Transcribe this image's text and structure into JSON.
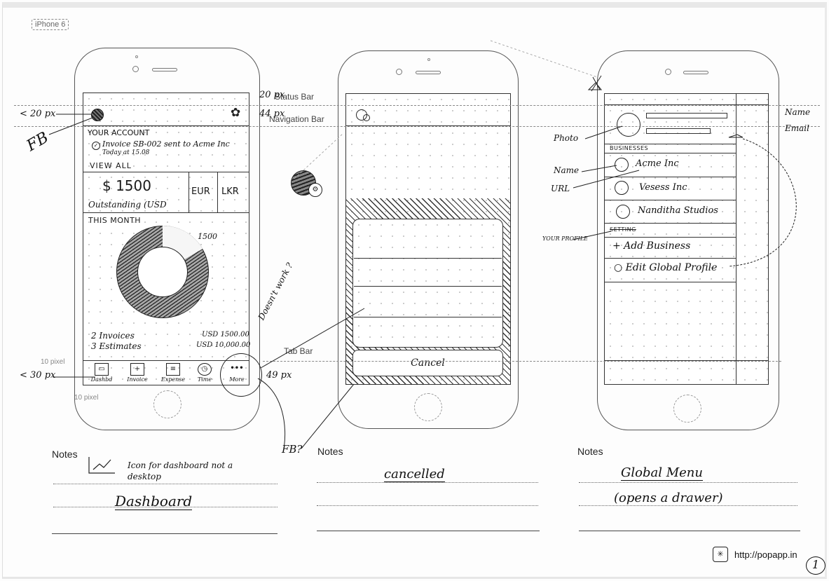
{
  "device_label": "iPhone 6",
  "guides": {
    "status_bar": "Status Bar",
    "navigation_bar": "Navigation Bar",
    "tab_bar": "Tab Bar",
    "ten_pixel_top": "10 pixel",
    "ten_pixel_bottom": "10 pixel"
  },
  "annotations": {
    "status_bar_px": "20 px",
    "nav_bar_px": "44 px",
    "avatar_size": "< 20 px",
    "fb_left": "FB",
    "tab_icon_size": "< 30 px",
    "tab_bar_px": "49 px",
    "doesnt_work": "Doesn't work ?",
    "fb_question": "FB?",
    "photo": "Photo",
    "name_left": "Name",
    "url": "URL",
    "your_profile": "YOUR PROFILE",
    "name_right": "Name",
    "email_right": "Email"
  },
  "screen1": {
    "section_title": "YOUR ACCOUNT",
    "activity_text": "Invoice SB-002 sent to Acme Inc",
    "activity_time": "Today at 15.08",
    "view_all": "VIEW ALL",
    "amount": "$ 1500",
    "amount_caption": "Outstanding (USD",
    "currency_tabs": [
      "EUR",
      "LKR"
    ],
    "month_title": "THIS MONTH",
    "donut_label": "1500",
    "summary": [
      {
        "label": "2 Invoices",
        "value": "USD 1500.00"
      },
      {
        "label": "3 Estimates",
        "value": "USD 10,000.00"
      }
    ],
    "tabs": [
      {
        "label": "Dashbd",
        "icon": "desktop-icon",
        "glyph": "▭"
      },
      {
        "label": "Invoice",
        "icon": "new-invoice-icon",
        "glyph": "+"
      },
      {
        "label": "Expense",
        "icon": "receipt-icon",
        "glyph": "≡"
      },
      {
        "label": "Time",
        "icon": "stopwatch-icon",
        "glyph": "◷"
      },
      {
        "label": "More",
        "icon": "more-dots-icon",
        "glyph": "•••"
      }
    ]
  },
  "screen2": {
    "cancel_label": "Cancel"
  },
  "screen3": {
    "businesses_header": "BUSINESSES",
    "businesses": [
      "Acme Inc",
      "Vesess Inc",
      "Nanditha Studios"
    ],
    "settings_header": "SETTING",
    "menu": [
      {
        "label": "+ Add Business",
        "icon": "plus-icon"
      },
      {
        "label": "○ Edit Global Profile",
        "icon": "circle-icon"
      }
    ]
  },
  "notes": [
    {
      "label": "Notes",
      "lines": [
        "Icon for dashboard not a desktop",
        "Dashboard"
      ]
    },
    {
      "label": "Notes",
      "lines": [
        "cancelled"
      ]
    },
    {
      "label": "Notes",
      "lines": [
        "Global Menu",
        "(opens a drawer)"
      ]
    }
  ],
  "footer": {
    "url": "http://popapp.in",
    "page_number": "1"
  }
}
